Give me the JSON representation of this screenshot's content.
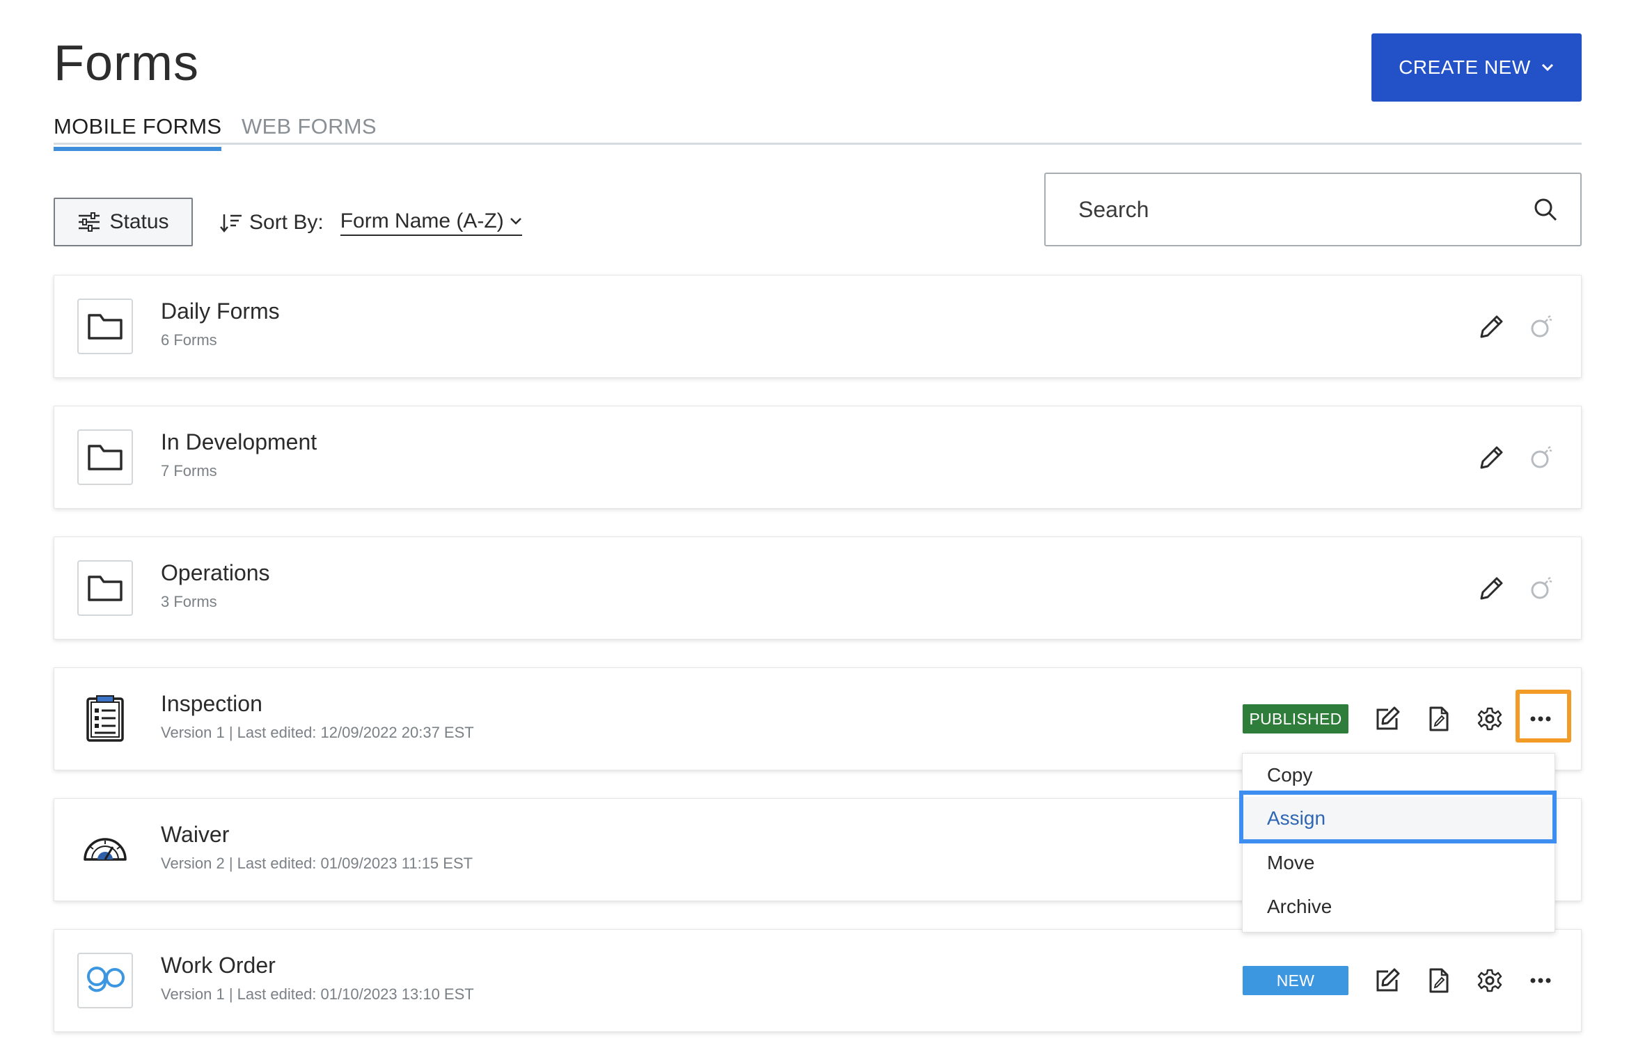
{
  "header": {
    "title": "Forms",
    "create_label": "CREATE NEW"
  },
  "tabs": [
    {
      "label": "MOBILE FORMS",
      "active": true
    },
    {
      "label": "WEB FORMS",
      "active": false
    }
  ],
  "toolbar": {
    "status_label": "Status",
    "sort_label": "Sort By:",
    "sort_value": "Form Name (A-Z)",
    "search_placeholder": "Search"
  },
  "folders": [
    {
      "name": "Daily Forms",
      "count": "6 Forms"
    },
    {
      "name": "In Development",
      "count": "7 Forms"
    },
    {
      "name": "Operations",
      "count": "3 Forms"
    }
  ],
  "forms": [
    {
      "name": "Inspection",
      "meta": "Version 1 | Last edited: 12/09/2022 20:37 EST",
      "badge": "PUBLISHED",
      "badge_color": "#2e7d3a",
      "icon": "clipboard-icon"
    },
    {
      "name": "Waiver",
      "meta": "Version 2 | Last edited: 01/09/2023 11:15 EST",
      "badge": "",
      "icon": "gauge-icon"
    },
    {
      "name": "Work Order",
      "meta": "Version 1 | Last edited: 01/10/2023 13:10 EST",
      "badge": "NEW",
      "badge_color": "#3d97e0",
      "icon": "go-logo-icon"
    }
  ],
  "context_menu": {
    "items": [
      "Copy",
      "Assign",
      "Move",
      "Archive"
    ],
    "highlighted": "Assign"
  },
  "colors": {
    "primary": "#2351c8",
    "tab_active": "#3f8edb",
    "more_highlight": "#f29b26",
    "assign_highlight": "#3e8ef1"
  }
}
